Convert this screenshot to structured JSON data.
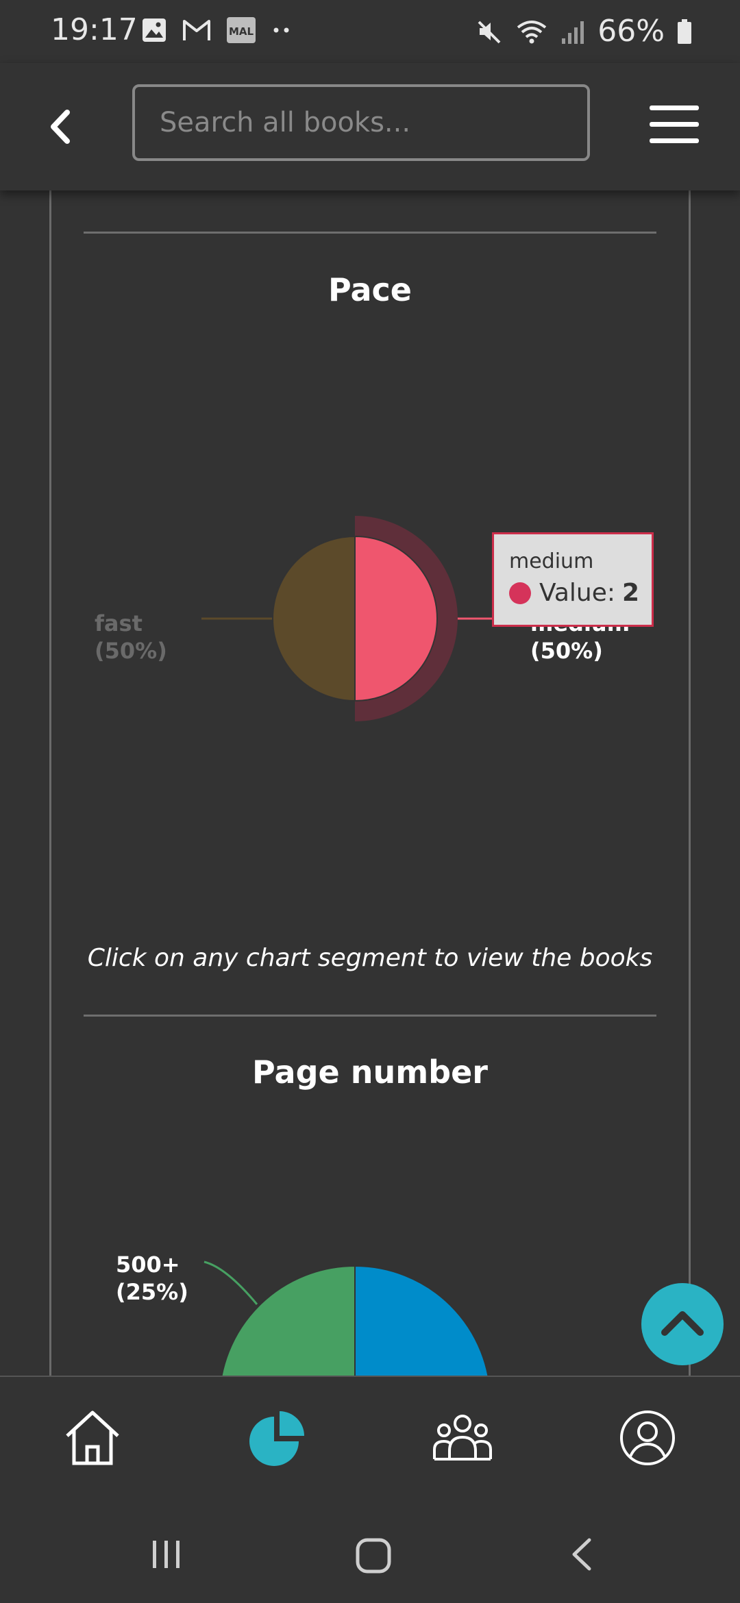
{
  "status": {
    "time": "19:17",
    "battery": "66%",
    "left_icons": [
      "gallery-icon",
      "gmail-icon",
      "mal-icon",
      "more-dots-icon"
    ],
    "right_icons": [
      "mute-icon",
      "wifi-icon",
      "signal-icon",
      "battery-icon"
    ]
  },
  "header": {
    "search_placeholder": "Search all books...",
    "back_icon": "chevron-left-icon",
    "menu_icon": "hamburger-icon"
  },
  "pace": {
    "title": "Pace",
    "hint": "Click on any chart segment to view the books",
    "tooltip": {
      "title": "medium",
      "label": "Value:",
      "value": "2"
    },
    "chart_data": {
      "type": "pie",
      "categories": [
        "fast",
        "medium"
      ],
      "values": [
        2,
        2
      ],
      "labels": [
        "fast\n(50%)",
        "medium\n(50%)"
      ],
      "label_fast_name": "fast",
      "label_fast_pct": "(50%)",
      "label_medium_name": "medium",
      "label_medium_pct": "(50%)",
      "colors": [
        "#5c4a2a",
        "#ef566e"
      ]
    }
  },
  "page_number": {
    "title": "Page number",
    "chart_data": {
      "type": "pie",
      "visible_label_name": "500+",
      "visible_label_pct": "(25%)",
      "colors": [
        "#47a062",
        "#008cca"
      ]
    }
  },
  "nav": {
    "items": [
      "home-icon",
      "stats-pie-icon",
      "community-icon",
      "profile-icon"
    ],
    "active": "stats-pie-icon",
    "accent": "#2ab3c4"
  }
}
